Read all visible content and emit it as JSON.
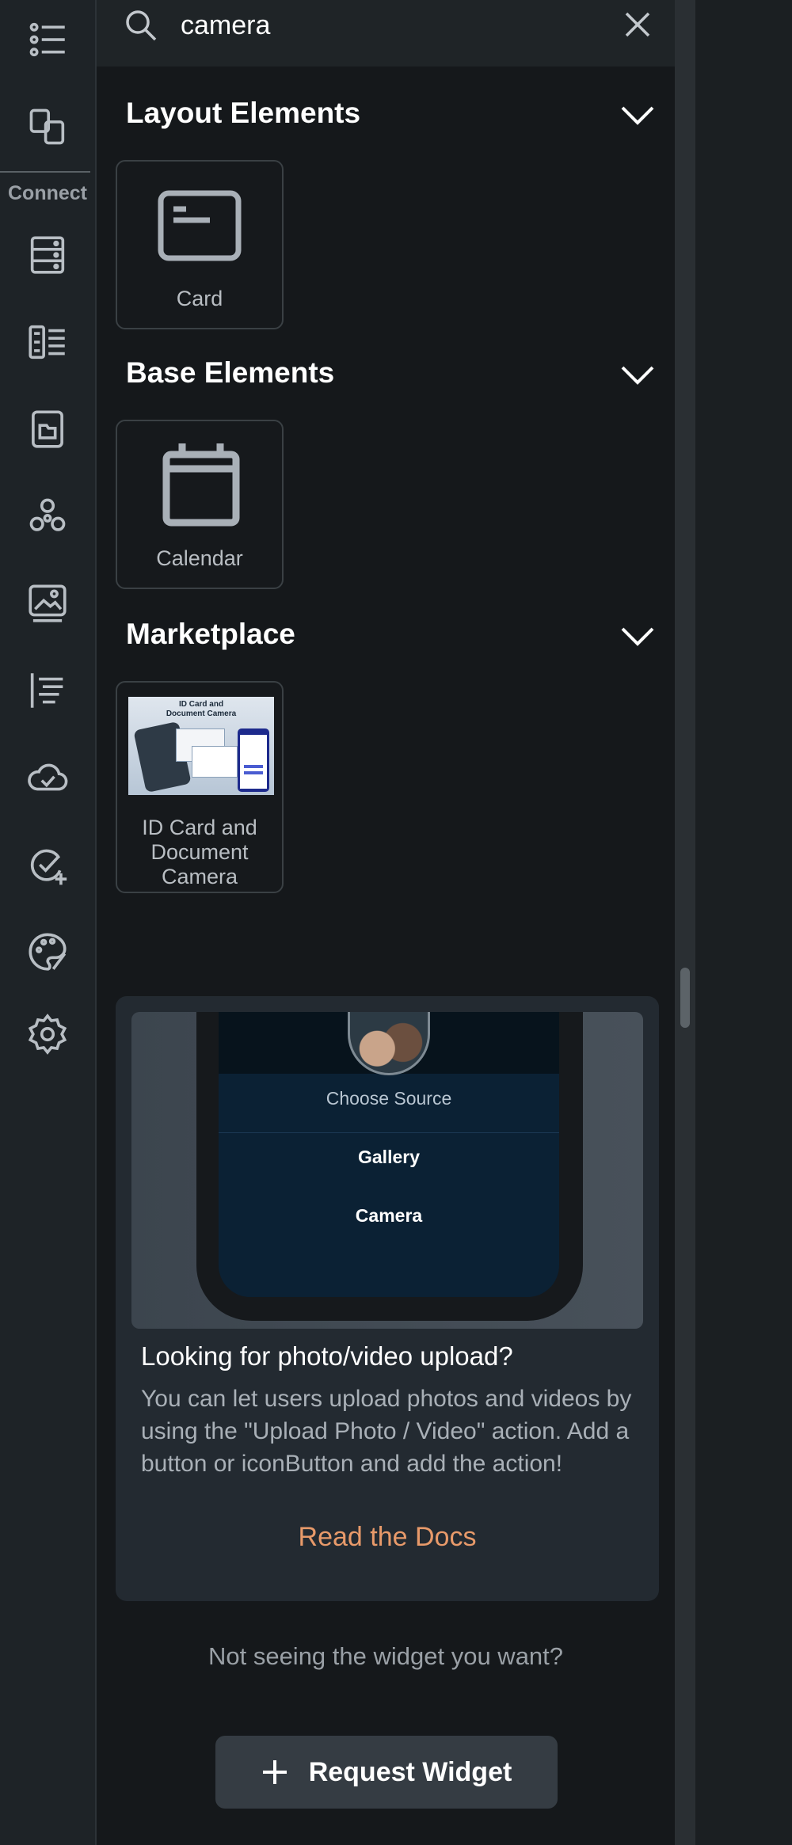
{
  "sidebar": {
    "connect_label": "Connect",
    "icons": [
      "widget-tree-icon",
      "device-preview-icon",
      "database-icon",
      "data-list-icon",
      "folder-icon",
      "integrations-icon",
      "media-icon",
      "text-styles-icon",
      "cloud-check-icon",
      "task-add-icon",
      "theme-palette-icon",
      "settings-gear-icon"
    ]
  },
  "search": {
    "value": "camera"
  },
  "sections": {
    "layout": {
      "title": "Layout Elements",
      "items": [
        {
          "label": "Card",
          "icon": "card-icon"
        }
      ]
    },
    "base": {
      "title": "Base Elements",
      "items": [
        {
          "label": "Calendar",
          "icon": "calendar-icon"
        }
      ]
    },
    "marketplace": {
      "title": "Marketplace",
      "items": [
        {
          "label": "ID Card and Document Camera",
          "thumbnail_title": "ID Card and Document Camera"
        }
      ]
    }
  },
  "info_card": {
    "preview": {
      "sheet_title": "Choose Source",
      "options": [
        "Gallery",
        "Camera"
      ]
    },
    "title": "Looking for photo/video upload?",
    "body": "You can let users upload photos and videos by using the \"Upload Photo / Video\" action. Add a button or iconButton and add the action!",
    "link": "Read the Docs"
  },
  "footer": {
    "prompt": "Not seeing the widget you want?",
    "request_button": "Request Widget"
  },
  "colors": {
    "background": "#15181b",
    "rail": "#1e2327",
    "accent_link": "#e89a6a",
    "card": "#232a31"
  }
}
